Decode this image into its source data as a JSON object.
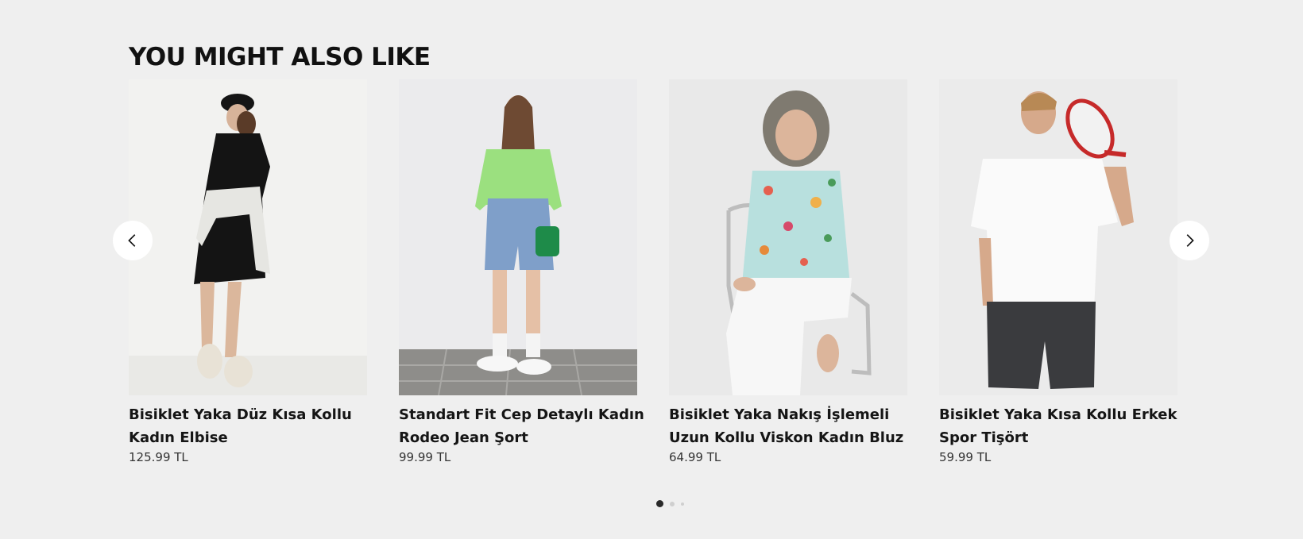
{
  "section": {
    "title": "YOU MIGHT ALSO LIKE"
  },
  "products": [
    {
      "name": "Bisiklet Yaka Düz Kısa Kollu Kadın Elbise",
      "price": "125.99 TL",
      "image_icon": "product-photo-black-dress"
    },
    {
      "name": "Standart Fit Cep Detaylı Kadın Rodeo Jean Şort",
      "price": "99.99 TL",
      "image_icon": "product-photo-jean-shorts"
    },
    {
      "name": "Bisiklet Yaka Nakış İşlemeli Uzun Kollu Viskon Kadın Bluz",
      "price": "64.99 TL",
      "image_icon": "product-photo-floral-blouse"
    },
    {
      "name": "Bisiklet Yaka Kısa Kollu Erkek Spor Tişört",
      "price": "59.99 TL",
      "image_icon": "product-photo-white-tshirt"
    }
  ],
  "carousel": {
    "prev_icon": "chevron-left-icon",
    "next_icon": "chevron-right-icon",
    "pages": 3,
    "active_page": 1
  },
  "colors": {
    "background": "#efefef",
    "text": "#111111",
    "dot_active": "#2a2a2a",
    "dot_inactive": "#cfcfcf"
  }
}
